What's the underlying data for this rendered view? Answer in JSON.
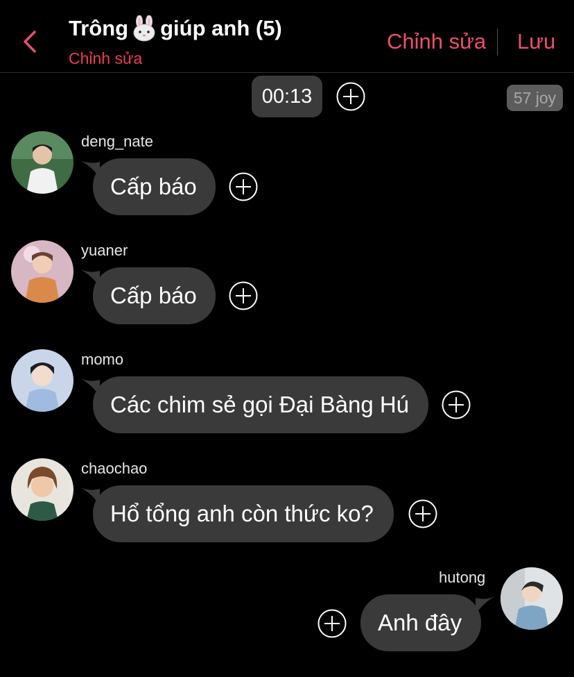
{
  "header": {
    "title_before": "Trông",
    "title_after": "giúp anh (5)",
    "subtitle": "Chỉnh sửa",
    "edit_label": "Chỉnh sửa",
    "save_label": "Lưu"
  },
  "time_label": "00:13",
  "joy_label": "57 joy",
  "messages": [
    {
      "user": "deng_nate",
      "text": "Cấp báo"
    },
    {
      "user": "yuaner",
      "text": "Cấp báo"
    },
    {
      "user": "momo",
      "text": "Các chim sẻ gọi Đại Bàng Hú"
    },
    {
      "user": "chaochao",
      "text": "Hổ tổng anh còn thức ko?"
    },
    {
      "user": "hutong",
      "text": "Anh đây"
    }
  ],
  "colors": {
    "accent": "#ef4e6c",
    "subtitle": "#ec3b57",
    "bubble": "#3a3a3a",
    "background": "#000000"
  }
}
